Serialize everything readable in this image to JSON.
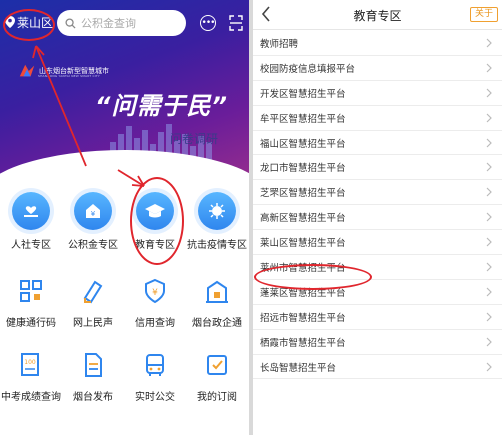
{
  "left": {
    "location": "莱山区",
    "search_placeholder": "公积金查询",
    "more_icon": "ellipsis-circle-icon",
    "scan_icon": "scan-icon",
    "banner": {
      "logo_text": "山东烟台新型智慧城市",
      "logo_sub": "SHANDONG YANTAI NEW SMART CITY",
      "slogan": "“问需于民”",
      "subtitle": "问卷调研"
    },
    "grid": [
      {
        "label": "人社专区",
        "icon": "hand-heart-icon"
      },
      {
        "label": "公积金专区",
        "icon": "house-yen-icon"
      },
      {
        "label": "教育专区",
        "icon": "graduation-cap-icon"
      },
      {
        "label": "抗击疫情专区",
        "icon": "virus-shield-icon"
      },
      {
        "label": "健康通行码",
        "icon": "qr-code-icon"
      },
      {
        "label": "网上民声",
        "icon": "pen-paper-icon"
      },
      {
        "label": "信用查询",
        "icon": "credit-shield-icon"
      },
      {
        "label": "烟台政企通",
        "icon": "building-icon"
      },
      {
        "label": "中考成绩查询",
        "icon": "score-100-icon"
      },
      {
        "label": "烟台发布",
        "icon": "document-icon"
      },
      {
        "label": "实时公交",
        "icon": "bus-icon"
      },
      {
        "label": "我的订阅",
        "icon": "subscription-icon"
      }
    ],
    "annotation_color": "#e0262d"
  },
  "right": {
    "title": "教育专区",
    "follow_label": "关于",
    "back_icon": "chevron-left-icon",
    "items": [
      "教师招聘",
      "校园防疫信息填报平台",
      "开发区智慧招生平台",
      "牟平区智慧招生平台",
      "福山区智慧招生平台",
      "龙口市智慧招生平台",
      "芝罘区智慧招生平台",
      "高新区智慧招生平台",
      "莱山区智慧招生平台",
      "莱州市智慧招生平台",
      "蓬莱区智慧招生平台",
      "招远市智慧招生平台",
      "栖霞市智慧招生平台",
      "长岛智慧招生平台"
    ]
  }
}
